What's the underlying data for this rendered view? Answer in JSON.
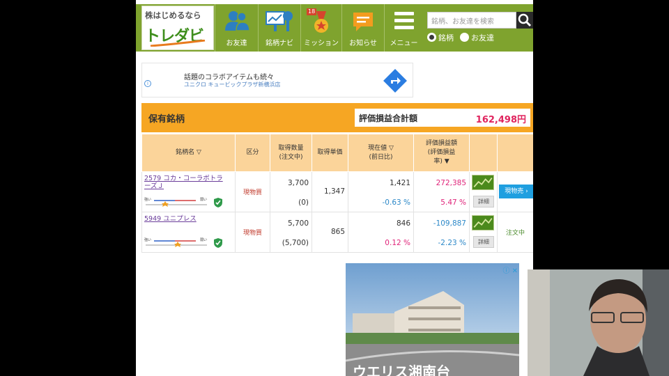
{
  "logo": {
    "tagline": "株はじめるなら",
    "brand": "トレダビ"
  },
  "nav": [
    {
      "label": "お友達",
      "icon": "friends-icon"
    },
    {
      "label": "銘柄ナビ",
      "icon": "stock-navi-icon"
    },
    {
      "label": "ミッション",
      "icon": "mission-medal-icon",
      "badge": "18"
    },
    {
      "label": "お知らせ",
      "icon": "notice-icon"
    },
    {
      "label": "メニュー",
      "icon": "menu-icon"
    }
  ],
  "search": {
    "placeholder": "銘柄、お友達を検索",
    "options": [
      {
        "label": "銘柄",
        "selected": true
      },
      {
        "label": "お友達",
        "selected": false
      }
    ]
  },
  "ad_top": {
    "line1": "話題のコラボアイテムも続々",
    "line2": "ユニクロ キュービックプラザ新横浜店"
  },
  "holdings": {
    "title": "保有銘柄",
    "total_label": "評価損益合計額",
    "total_value": "162,498円",
    "columns": {
      "name": "銘柄名 ▽",
      "kubun": "区分",
      "qty_line1": "取得数量",
      "qty_line2": "(注文中)",
      "price": "取得単価",
      "now_line1": "現在値 ▽",
      "now_line2": "(前日比)",
      "pl_line1": "評価損益額",
      "pl_line2": "(評価損益",
      "pl_line3": "率) ▼"
    },
    "rows": [
      {
        "name": "2579 コカ・コーラボトラーズＪ",
        "meter_left": "強い",
        "meter_right": "弱い",
        "kubun": "現物買",
        "qty": "3,700",
        "qty_pending": "(0)",
        "price": "1,347",
        "now": "1,421",
        "change": "-0.63 %",
        "pl": "272,385",
        "pl_rate": "5.47 %",
        "detail": "詳細",
        "action": "現物売 ›"
      },
      {
        "name": "5949 ユニプレス",
        "meter_left": "強い",
        "meter_right": "弱い",
        "kubun": "現物買",
        "qty": "5,700",
        "qty_pending": "(5,700)",
        "price": "865",
        "now": "846",
        "change": "0.12 %",
        "pl": "-109,887",
        "pl_rate": "-2.23 %",
        "detail": "詳細",
        "action": "注文中"
      }
    ]
  },
  "ad_bottom": {
    "caption": "ウエリス湘南台"
  },
  "colors": {
    "header": "#7fa32e",
    "orange": "#f6a623",
    "header_cell": "#fbd49a",
    "pink": "#e0247a",
    "blue": "#2c88c8"
  }
}
